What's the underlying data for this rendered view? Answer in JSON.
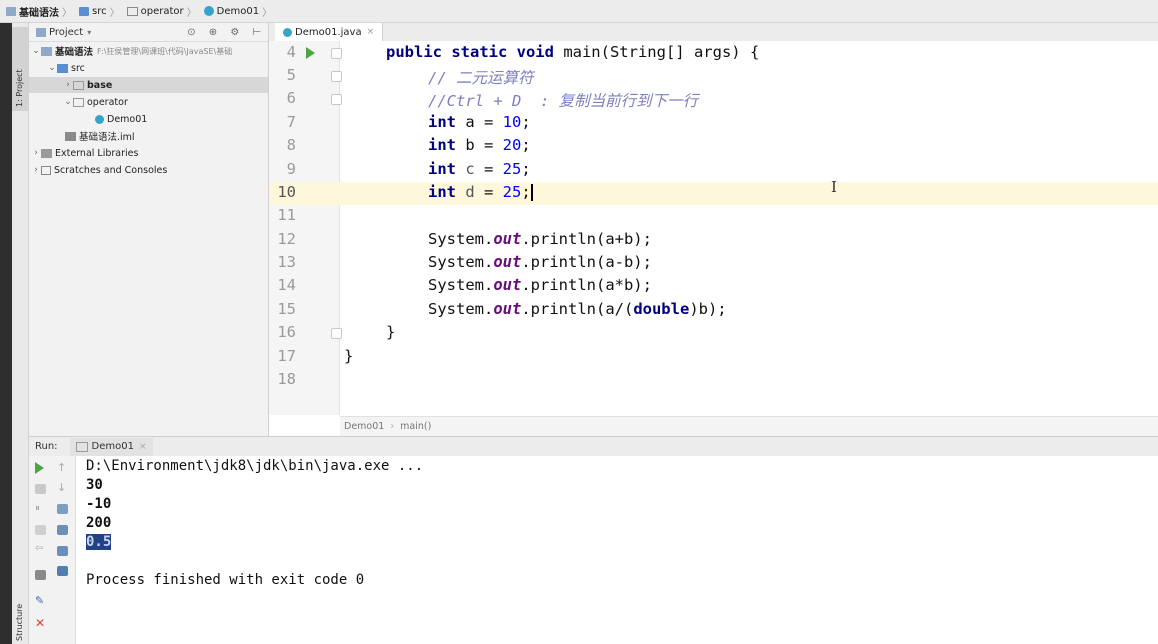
{
  "breadcrumb": [
    "基础语法",
    "src",
    "operator",
    "Demo01"
  ],
  "left_strip": {
    "project_label": "1: Project",
    "structure_label": "Structure"
  },
  "project_panel": {
    "title": "Project",
    "tree": [
      {
        "label": "基础语法",
        "path": "F:\\狂侯管理\\网课班\\代码\\JavaSE\\基础",
        "level": 0,
        "expanded": true,
        "icon": "module-folder-icon"
      },
      {
        "label": "src",
        "level": 1,
        "expanded": true,
        "icon": "source-folder-icon"
      },
      {
        "label": "base",
        "level": 2,
        "expanded": false,
        "icon": "package-icon",
        "selected": true
      },
      {
        "label": "operator",
        "level": 2,
        "expanded": true,
        "icon": "package-icon"
      },
      {
        "label": "Demo01",
        "level": 3,
        "icon": "class-icon"
      },
      {
        "label": "基础语法.iml",
        "level": 2,
        "icon": "iml-file-icon"
      },
      {
        "label": "External Libraries",
        "level": 0,
        "expanded": false,
        "icon": "libraries-icon"
      },
      {
        "label": "Scratches and Consoles",
        "level": 0,
        "expanded": false,
        "icon": "scratches-icon"
      }
    ]
  },
  "editor": {
    "tab_label": "Demo01.java",
    "current_line": 10,
    "line_numbers": [
      "4",
      "5",
      "6",
      "7",
      "8",
      "9",
      "10",
      "11",
      "12",
      "13",
      "14",
      "15",
      "16",
      "17",
      "18"
    ],
    "lines": {
      "l4": {
        "kw1": "public static void ",
        "rest": "main(String[] args) {"
      },
      "l5": {
        "comment": "// 二元运算符"
      },
      "l6": {
        "comment": "//Ctrl + D  : 复制当前行到下一行"
      },
      "l7": {
        "kw": "int ",
        "var": "a",
        "eq": " = ",
        "num": "10",
        "semi": ";"
      },
      "l8": {
        "kw": "int ",
        "var": "b",
        "eq": " = ",
        "num": "20",
        "semi": ";"
      },
      "l9": {
        "kw": "int ",
        "var": "c",
        "eq": " = ",
        "num": "25",
        "semi": ";"
      },
      "l10": {
        "kw": "int ",
        "var": "d",
        "eq": " = ",
        "num": "25",
        "semi": ";"
      },
      "l12": {
        "pre": "System.",
        "out": "out",
        "post": ".println(a+b);"
      },
      "l13": {
        "pre": "System.",
        "out": "out",
        "post": ".println(a-b);"
      },
      "l14": {
        "pre": "System.",
        "out": "out",
        "post": ".println(a*b);"
      },
      "l15": {
        "pre": "System.",
        "out": "out",
        "post_a": ".println(a/(",
        "kw": "double",
        "post_b": ")b);"
      },
      "l16": {
        "text": "}"
      },
      "l17": {
        "text": "}"
      }
    },
    "breadcrumb": [
      "Demo01",
      "main()"
    ]
  },
  "run_panel": {
    "label": "Run:",
    "tab_label": "Demo01",
    "console_lines": [
      "D:\\Environment\\jdk8\\jdk\\bin\\java.exe ...",
      "30",
      "-10",
      "200",
      "0.5",
      "",
      "Process finished with exit code 0"
    ],
    "highlighted_line_index": 4
  },
  "colors": {
    "run_green": "#4aa744",
    "keyword": "#000080",
    "comment": "#7f7fbf",
    "static_field": "#660e7a",
    "number": "#0000ff",
    "current_line": "#fdf7dc",
    "selection": "#214283"
  }
}
